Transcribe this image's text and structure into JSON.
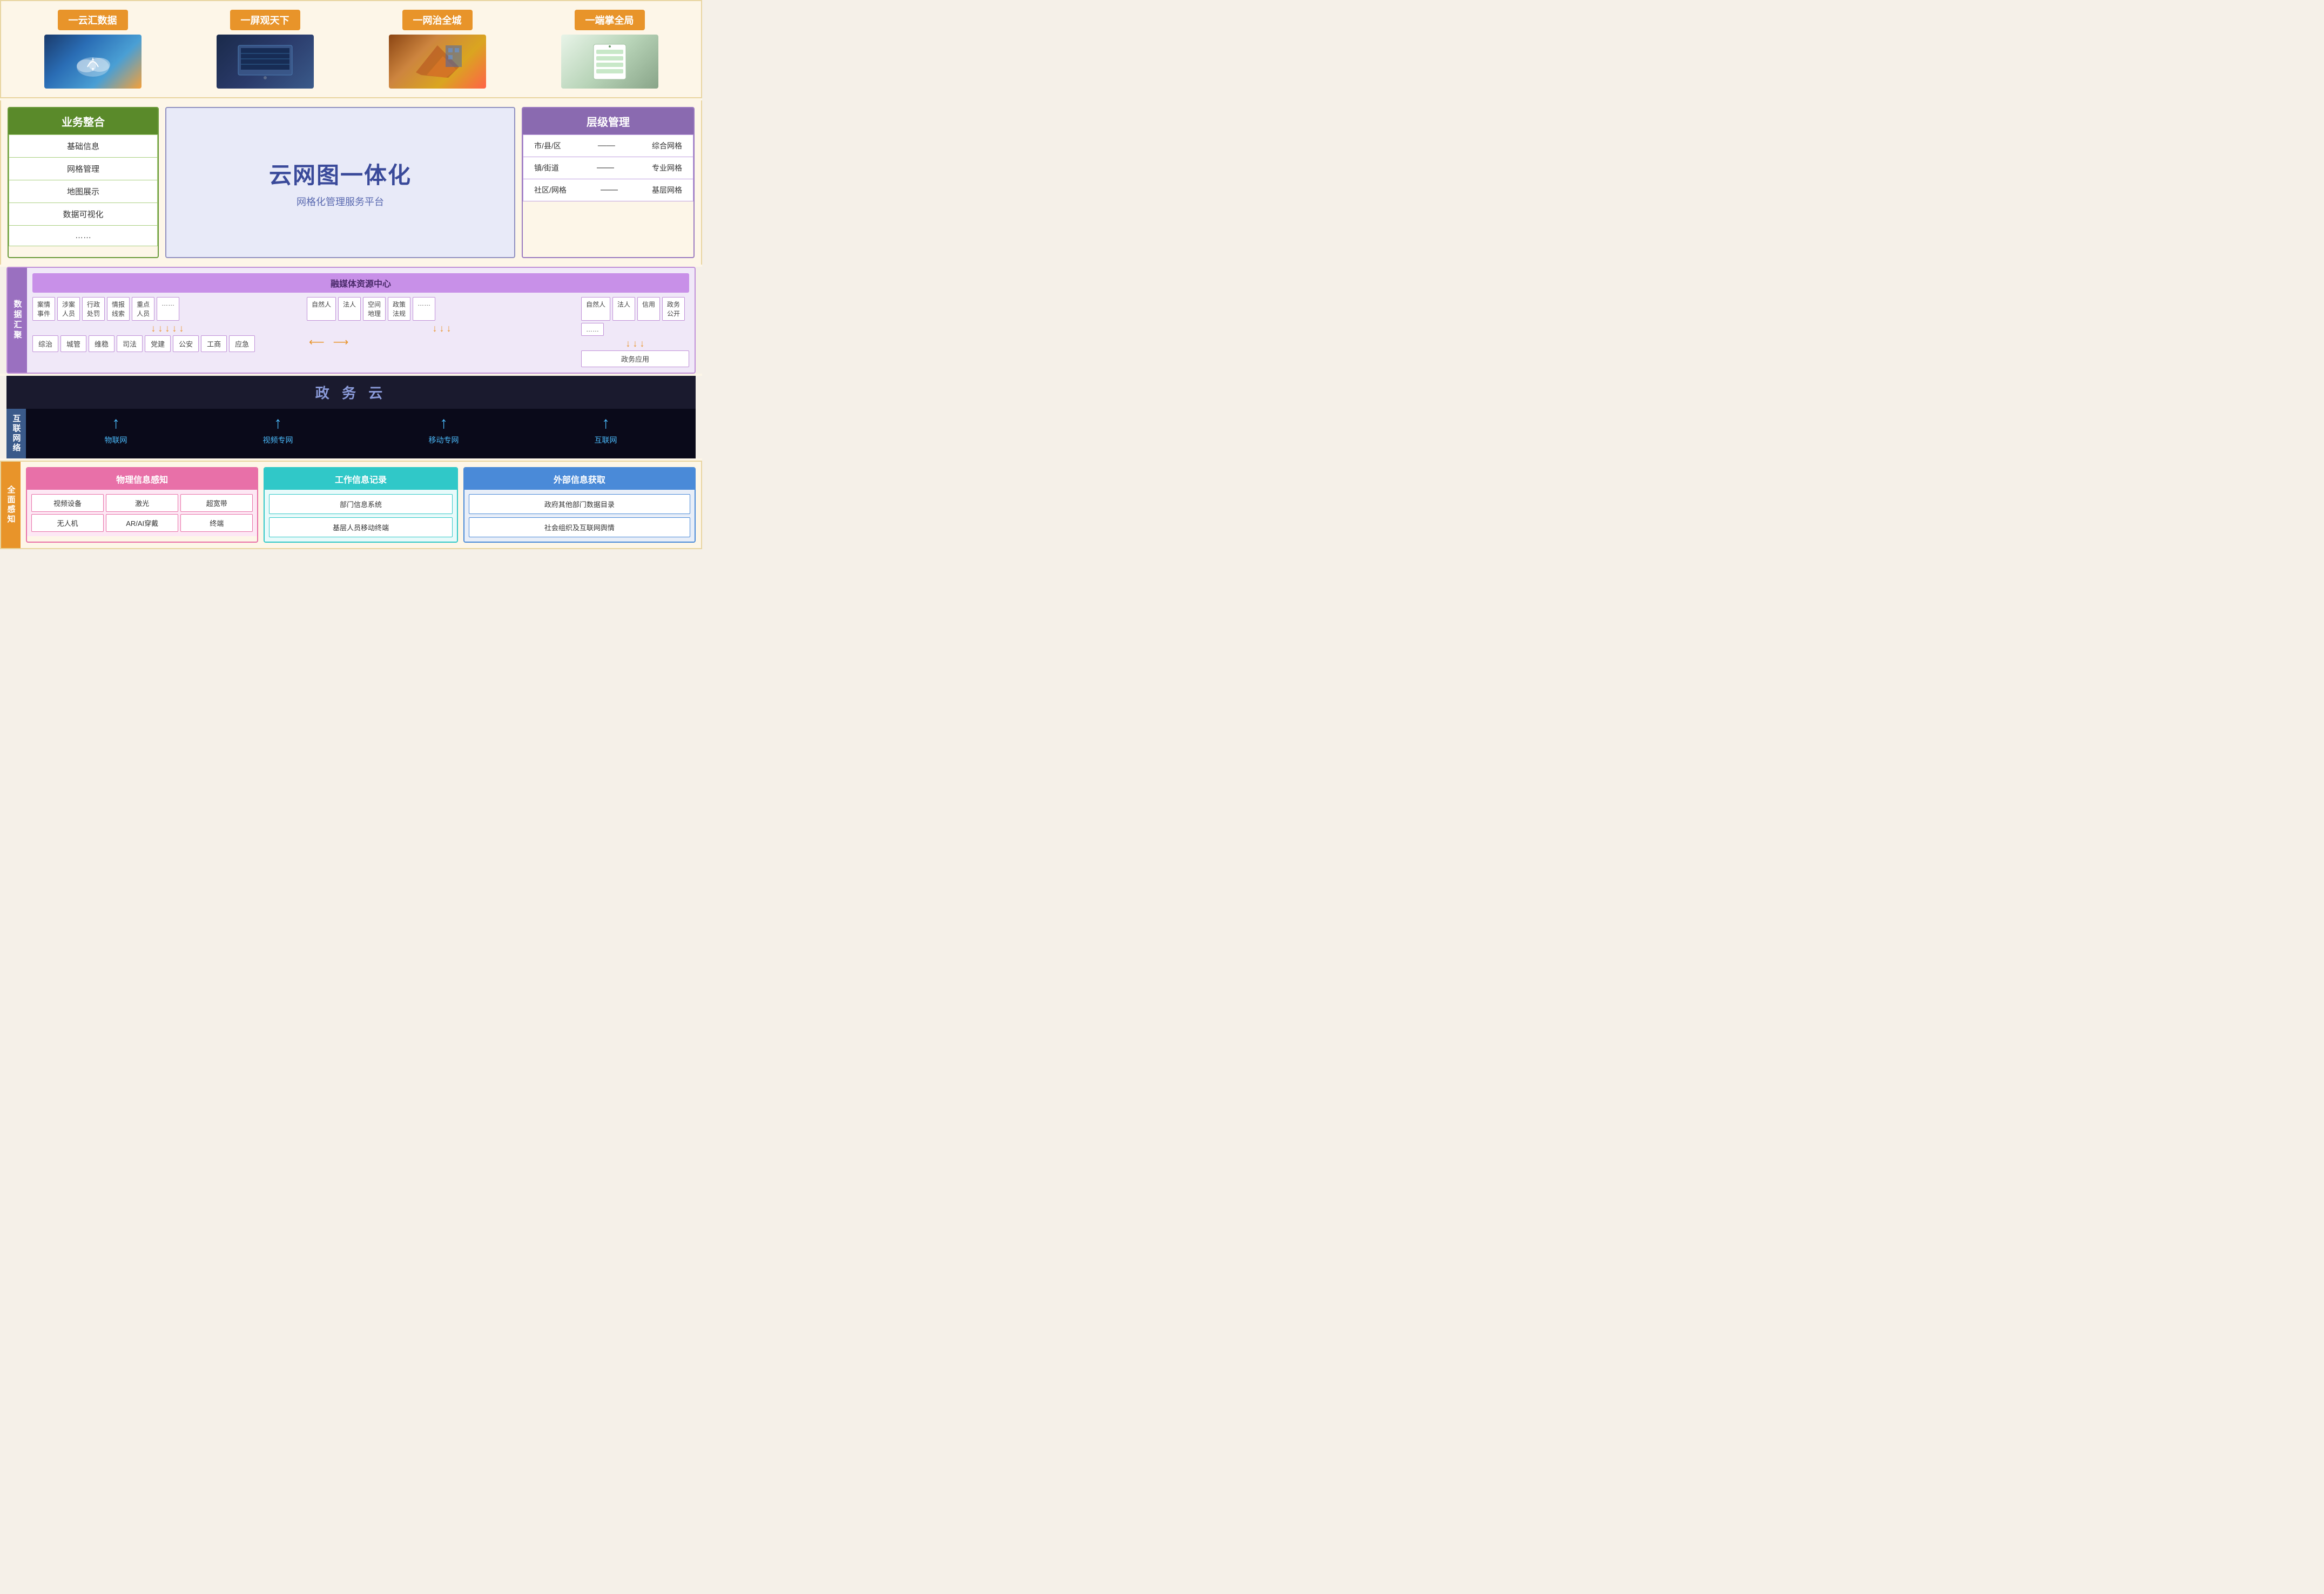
{
  "top": {
    "cards": [
      {
        "id": "cloud-data",
        "label": "一云汇数据",
        "imgType": "cloud"
      },
      {
        "id": "screen-view",
        "label": "一屏观天下",
        "imgType": "screen"
      },
      {
        "id": "net-city",
        "label": "一网治全城",
        "imgType": "map"
      },
      {
        "id": "end-control",
        "label": "一端掌全局",
        "imgType": "app"
      }
    ]
  },
  "business": {
    "header": "业务整合",
    "items": [
      "基础信息",
      "网格管理",
      "地图展示",
      "数据可视化",
      "……"
    ]
  },
  "center": {
    "title": "云网图一体化",
    "subtitle": "网格化管理服务平台"
  },
  "level": {
    "header": "层级管理",
    "rows": [
      {
        "left": "市/县/区",
        "right": "综合网格"
      },
      {
        "left": "镇/街道",
        "right": "专业网格"
      },
      {
        "left": "社区/网格",
        "right": "基层网格"
      }
    ],
    "dash": "——"
  },
  "data_aggregation": {
    "label": "数据汇聚",
    "media_center": "融媒体资源中心",
    "left_tags": [
      "案情事件",
      "涉案人员",
      "行政处罚",
      "情报线索",
      "重点人员",
      "……"
    ],
    "left_gov_tags": [
      "综治",
      "城管",
      "维稳",
      "司法",
      "党建",
      "公安",
      "工商",
      "应急"
    ],
    "middle_tags": [
      "自然人",
      "法人",
      "空间地理",
      "政策法规",
      "……"
    ],
    "right_tags": [
      "自然人",
      "法人",
      "信用",
      "政务公开",
      "……"
    ],
    "right_bottom": "政务应用"
  },
  "gov_cloud": {
    "text": "政 务 云"
  },
  "network": {
    "label": "互联网络",
    "items": [
      {
        "id": "iot",
        "label": "物联网"
      },
      {
        "id": "video",
        "label": "视频专网"
      },
      {
        "id": "mobile",
        "label": "移动专网"
      },
      {
        "id": "internet",
        "label": "互联网"
      }
    ]
  },
  "bottom": {
    "label": "全面感知",
    "physical": {
      "header": "物理信息感知",
      "items": [
        "视频设备",
        "激光",
        "超宽带",
        "无人机",
        "AR/AI穿戴",
        "终端"
      ]
    },
    "work": {
      "header": "工作信息记录",
      "items": [
        "部门信息系统",
        "基层人员移动终端"
      ]
    },
    "external": {
      "header": "外部信息获取",
      "items": [
        "政府其他部门数据目录",
        "社会组织及互联网舆情"
      ]
    }
  }
}
